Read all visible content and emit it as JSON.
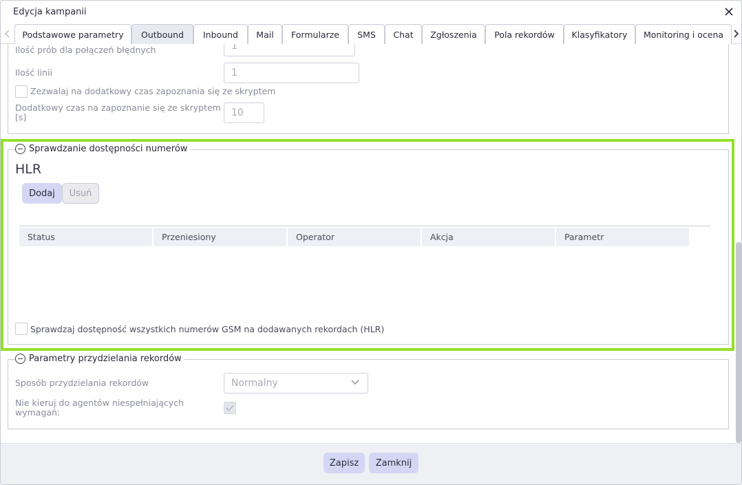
{
  "dialog": {
    "title": "Edycja kampanii"
  },
  "tabs": [
    {
      "label": "Podstawowe parametry",
      "active": false
    },
    {
      "label": "Outbound",
      "active": true
    },
    {
      "label": "Inbound",
      "active": false
    },
    {
      "label": "Mail",
      "active": false
    },
    {
      "label": "Formularze",
      "active": false
    },
    {
      "label": "SMS",
      "active": false
    },
    {
      "label": "Chat",
      "active": false
    },
    {
      "label": "Zgłoszenia",
      "active": false
    },
    {
      "label": "Pola rekordów",
      "active": false
    },
    {
      "label": "Klasyfikatory",
      "active": false
    },
    {
      "label": "Monitoring i ocena",
      "active": false
    }
  ],
  "outbound_section": {
    "failed_attempts": {
      "label": "Ilość prób dla połączeń błędnych",
      "value": "1"
    },
    "lines": {
      "label": "Ilość linii",
      "value": "1"
    },
    "allow_extra_time": {
      "label": "Zezwalaj na dodatkowy czas zapoznania się ze skryptem",
      "checked": false
    },
    "extra_time": {
      "label_line1": "Dodatkowy czas na zapoznanie się ze skryptem",
      "label_line2": "[s]",
      "value": "10"
    }
  },
  "availability_section": {
    "legend": "Sprawdzanie dostępności numerów",
    "heading": "HLR",
    "add_label": "Dodaj",
    "remove_label": "Usuń",
    "columns": [
      "Status",
      "Przeniesiony",
      "Operator",
      "Akcja",
      "Parametr"
    ],
    "check_all": {
      "label": "Sprawdzaj dostępność wszystkich numerów GSM na dodawanych rekordach (HLR)",
      "checked": false
    }
  },
  "assignment_section": {
    "legend": "Parametry przydzielania rekordów",
    "method": {
      "label": "Sposób przydzielania rekordów",
      "value": "Normalny"
    },
    "skip_agents": {
      "label_line1": "Nie kieruj do agentów niespełniających",
      "label_line2": "wymagań:",
      "checked": true
    }
  },
  "footer": {
    "save_label": "Zapisz",
    "close_label": "Zamknij"
  },
  "colors": {
    "highlight": "#93e02b",
    "primary_button": "#d4d7f4",
    "active_tab": "#e8eaf2"
  }
}
